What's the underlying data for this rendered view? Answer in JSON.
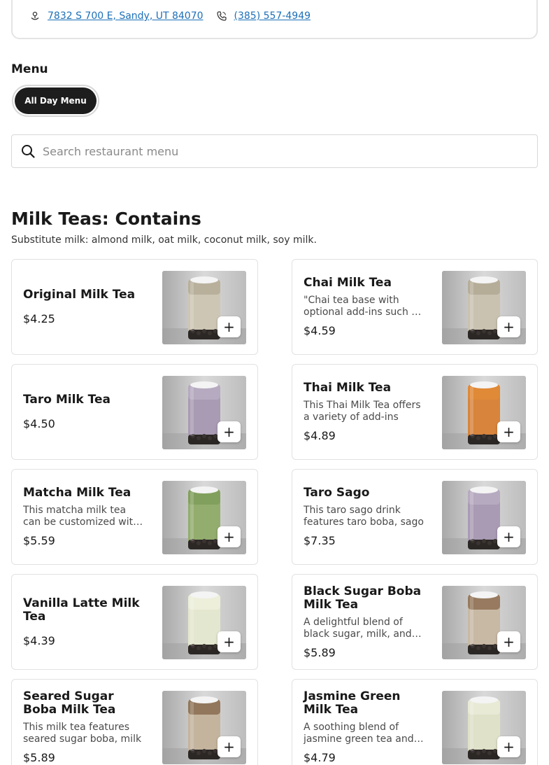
{
  "restaurant": {
    "address": "7832 S 700 E, Sandy, UT 84070",
    "phone": "(385) 557-4949"
  },
  "menu": {
    "heading": "Menu",
    "active_menu": "All Day Menu",
    "search_placeholder": "Search restaurant menu"
  },
  "section": {
    "title": "Milk Teas: Contains",
    "subtitle": "Substitute milk: almond milk, oat milk, coconut milk, soy milk."
  },
  "items": [
    {
      "name": "Original Milk Tea",
      "desc": "",
      "price": "$4.25",
      "tea_color": "#cdc6b4",
      "top_color": "#b5ab98"
    },
    {
      "name": "Chai Milk Tea",
      "desc": "\"Chai tea base with optional add-ins such as boba",
      "price": "$4.59",
      "tea_color": "#c9c2b0",
      "top_color": "#b3a995"
    },
    {
      "name": "Taro Milk Tea",
      "desc": "",
      "price": "$4.50",
      "tea_color": "#a99bb4",
      "top_color": "#b9adc2"
    },
    {
      "name": "Thai Milk Tea",
      "desc": "This Thai Milk Tea offers a variety of add-ins",
      "price": "$4.89",
      "tea_color": "#d8843c",
      "top_color": "#e28a35"
    },
    {
      "name": "Matcha Milk Tea",
      "desc": "This matcha milk tea can be customized with toppings",
      "price": "$5.59",
      "tea_color": "#93ad6e",
      "top_color": "#7f9d5a"
    },
    {
      "name": "Taro Sago",
      "desc": "This taro sago drink features taro boba, sago",
      "price": "$7.35",
      "tea_color": "#a99bb4",
      "top_color": "#b9adc2"
    },
    {
      "name": "Vanilla Latte Milk Tea",
      "desc": "",
      "price": "$4.39",
      "tea_color": "#e4e7cf",
      "top_color": "#eef0dd"
    },
    {
      "name": "Black Sugar Boba Milk Tea",
      "desc": "A delightful blend of black sugar, milk, and boba",
      "price": "$5.89",
      "tea_color": "#c8b9a5",
      "top_color": "#8e6f52"
    },
    {
      "name": "Seared Sugar Boba Milk Tea",
      "desc": "This milk tea features seared sugar boba, milk",
      "price": "$5.89",
      "tea_color": "#c4b49e",
      "top_color": "#8a6c50"
    },
    {
      "name": "Jasmine Green Milk Tea",
      "desc": "A soothing blend of jasmine green tea and milk",
      "price": "$4.79",
      "tea_color": "#dfe1c8",
      "top_color": "#eaebd8"
    }
  ],
  "icons": {
    "address": "location-icon",
    "phone": "phone-icon",
    "search": "search-icon",
    "add": "+"
  },
  "colors": {
    "link": "#1c6fb8",
    "pill_bg": "#1d1d1d"
  }
}
